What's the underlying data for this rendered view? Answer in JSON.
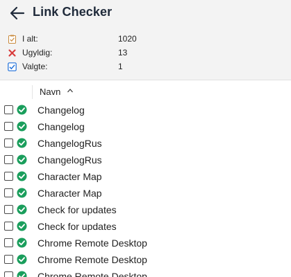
{
  "header": {
    "title": "Link Checker",
    "back_icon": "arrow-left-icon"
  },
  "stats": [
    {
      "label": "I alt:",
      "value": "1020",
      "icon": "clipboard-check-icon"
    },
    {
      "label": "Ugyldig:",
      "value": "13",
      "icon": "red-x-icon"
    },
    {
      "label": "Valgte:",
      "value": "1",
      "icon": "checked-box-icon"
    }
  ],
  "column": {
    "name_label": "Navn",
    "sort": "ascending"
  },
  "rows": [
    {
      "label": "Changelog",
      "checked": false,
      "status": "valid"
    },
    {
      "label": "Changelog",
      "checked": false,
      "status": "valid"
    },
    {
      "label": "ChangelogRus",
      "checked": false,
      "status": "valid"
    },
    {
      "label": "ChangelogRus",
      "checked": false,
      "status": "valid"
    },
    {
      "label": "Character Map",
      "checked": false,
      "status": "valid"
    },
    {
      "label": "Character Map",
      "checked": false,
      "status": "valid"
    },
    {
      "label": "Check for updates",
      "checked": false,
      "status": "valid"
    },
    {
      "label": "Check for updates",
      "checked": false,
      "status": "valid"
    },
    {
      "label": "Chrome Remote Desktop",
      "checked": false,
      "status": "valid"
    },
    {
      "label": "Chrome Remote Desktop",
      "checked": false,
      "status": "valid"
    },
    {
      "label": "Chrome Remote Desktop",
      "checked": false,
      "status": "valid"
    }
  ],
  "colors": {
    "valid_green": "#1a9e5c",
    "invalid_red": "#d83b3b",
    "selected_blue": "#1e6fd9",
    "panel_bg": "#f3f3f3"
  }
}
